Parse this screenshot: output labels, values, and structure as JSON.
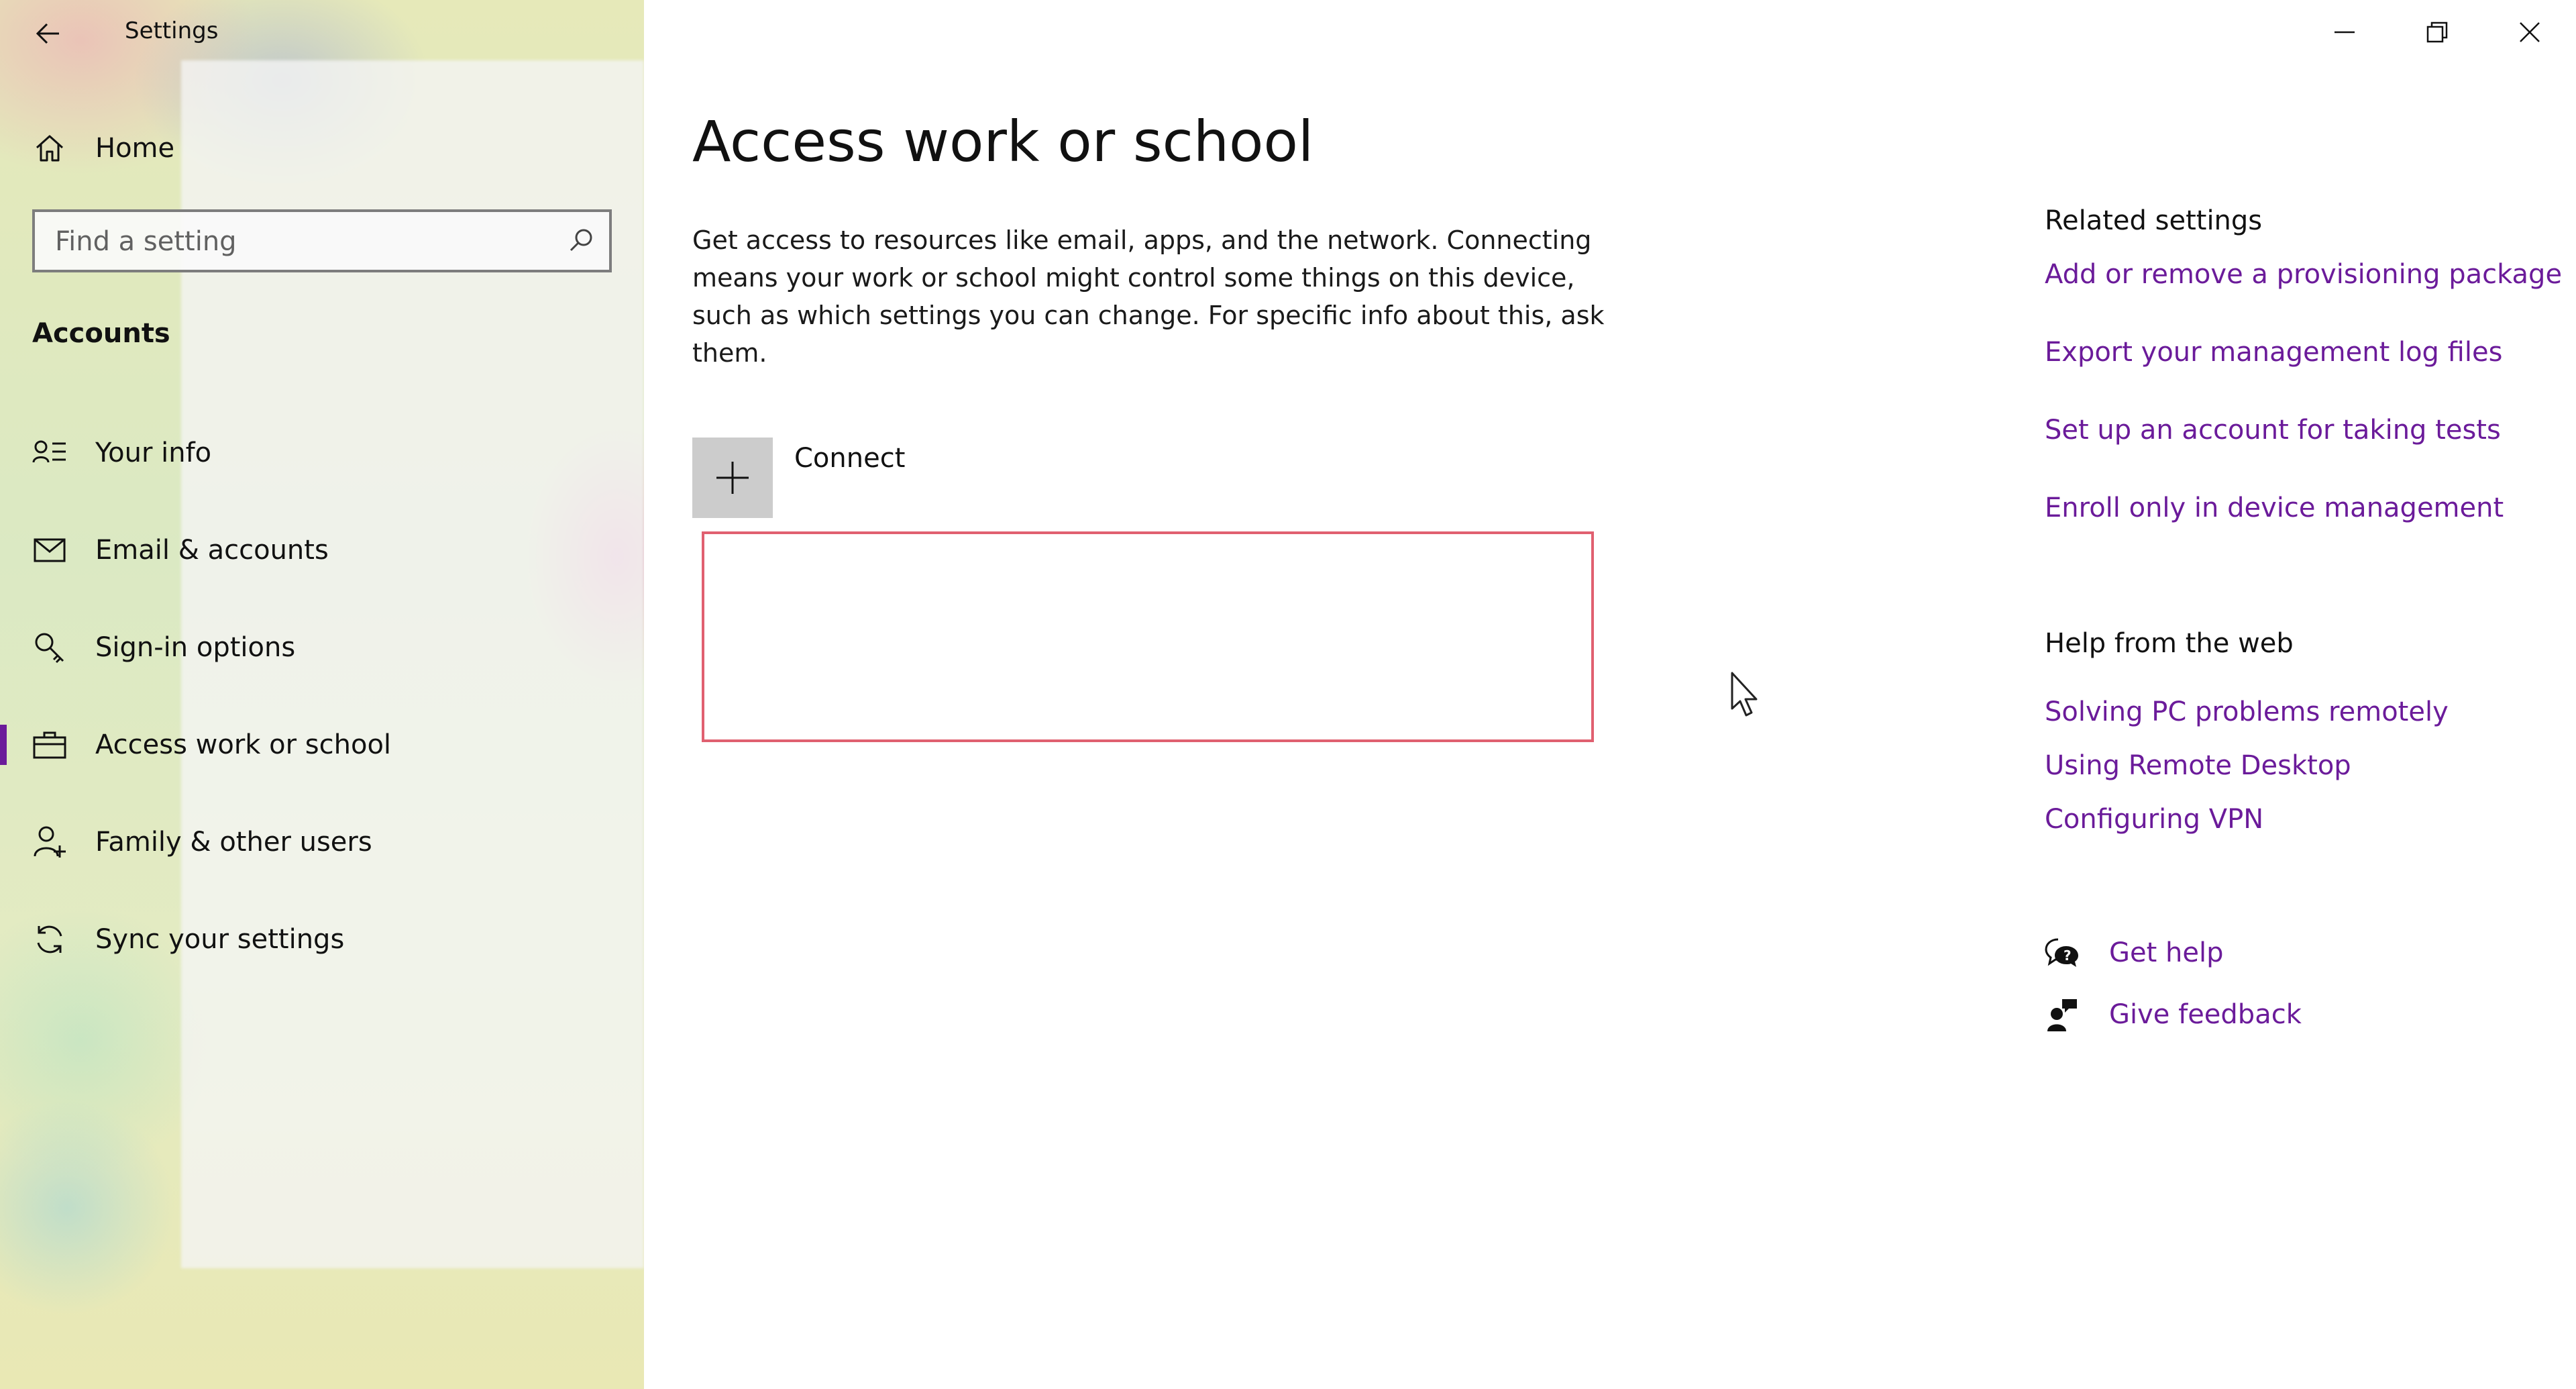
{
  "window": {
    "title": "Settings",
    "controls": {
      "minimize": "minimize-icon",
      "restore": "restore-icon",
      "close": "close-icon"
    }
  },
  "sidebar": {
    "home_label": "Home",
    "search": {
      "placeholder": "Find a setting",
      "value": ""
    },
    "section_heading": "Accounts",
    "items": [
      {
        "label": "Your info",
        "icon": "contact-info-icon",
        "selected": false
      },
      {
        "label": "Email & accounts",
        "icon": "mail-icon",
        "selected": false
      },
      {
        "label": "Sign-in options",
        "icon": "key-icon",
        "selected": false
      },
      {
        "label": "Access work or school",
        "icon": "briefcase-icon",
        "selected": true
      },
      {
        "label": "Family & other users",
        "icon": "add-person-icon",
        "selected": false
      },
      {
        "label": "Sync your settings",
        "icon": "sync-icon",
        "selected": false
      }
    ]
  },
  "main": {
    "title": "Access work or school",
    "description": "Get access to resources like email, apps, and the network. Connecting means your work or school might control some things on this device, such as which settings you can change. For specific info about this, ask them.",
    "connect_label": "Connect"
  },
  "related": {
    "heading": "Related settings",
    "links": [
      "Add or remove a provisioning package",
      "Export your management log files",
      "Set up an account for taking tests",
      "Enroll only in device management"
    ]
  },
  "help_web": {
    "heading": "Help from the web",
    "links": [
      "Solving PC problems remotely",
      "Using Remote Desktop",
      "Configuring VPN"
    ]
  },
  "support": {
    "get_help": "Get help",
    "give_feedback": "Give feedback"
  },
  "colors": {
    "accent": "#6b1b9a",
    "highlight_border": "#e06070",
    "connect_tile": "#cccccc"
  }
}
